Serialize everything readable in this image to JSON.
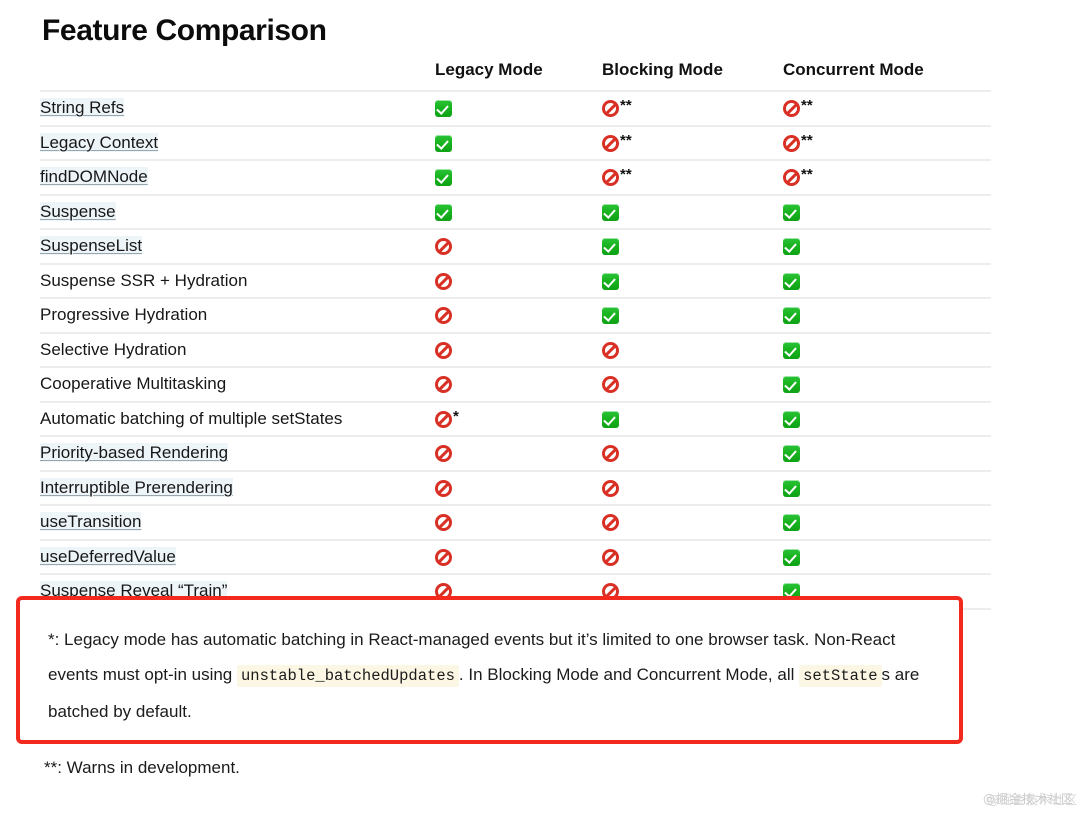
{
  "title": "Feature Comparison",
  "table": {
    "columns": [
      "",
      "Legacy Mode",
      "Blocking Mode",
      "Concurrent Mode"
    ],
    "legend": {
      "yes": "supported-check-icon",
      "no": "prohibited-icon",
      "single_star": "*",
      "double_star": "**"
    },
    "rows": [
      {
        "feature": "String Refs",
        "is_link": true,
        "legacy": "yes",
        "legacy_note": "",
        "blocking": "no",
        "blocking_note": "**",
        "concurrent": "no",
        "concurrent_note": "**"
      },
      {
        "feature": "Legacy Context",
        "is_link": true,
        "legacy": "yes",
        "legacy_note": "",
        "blocking": "no",
        "blocking_note": "**",
        "concurrent": "no",
        "concurrent_note": "**"
      },
      {
        "feature": "findDOMNode",
        "is_link": true,
        "legacy": "yes",
        "legacy_note": "",
        "blocking": "no",
        "blocking_note": "**",
        "concurrent": "no",
        "concurrent_note": "**"
      },
      {
        "feature": "Suspense",
        "is_link": true,
        "legacy": "yes",
        "legacy_note": "",
        "blocking": "yes",
        "blocking_note": "",
        "concurrent": "yes",
        "concurrent_note": ""
      },
      {
        "feature": "SuspenseList",
        "is_link": true,
        "legacy": "no",
        "legacy_note": "",
        "blocking": "yes",
        "blocking_note": "",
        "concurrent": "yes",
        "concurrent_note": ""
      },
      {
        "feature": "Suspense SSR + Hydration",
        "is_link": false,
        "legacy": "no",
        "legacy_note": "",
        "blocking": "yes",
        "blocking_note": "",
        "concurrent": "yes",
        "concurrent_note": ""
      },
      {
        "feature": "Progressive Hydration",
        "is_link": false,
        "legacy": "no",
        "legacy_note": "",
        "blocking": "yes",
        "blocking_note": "",
        "concurrent": "yes",
        "concurrent_note": ""
      },
      {
        "feature": "Selective Hydration",
        "is_link": false,
        "legacy": "no",
        "legacy_note": "",
        "blocking": "no",
        "blocking_note": "",
        "concurrent": "yes",
        "concurrent_note": ""
      },
      {
        "feature": "Cooperative Multitasking",
        "is_link": false,
        "legacy": "no",
        "legacy_note": "",
        "blocking": "no",
        "blocking_note": "",
        "concurrent": "yes",
        "concurrent_note": ""
      },
      {
        "feature": "Automatic batching of multiple setStates",
        "is_link": false,
        "legacy": "no",
        "legacy_note": "*",
        "blocking": "yes",
        "blocking_note": "",
        "concurrent": "yes",
        "concurrent_note": ""
      },
      {
        "feature": "Priority-based Rendering",
        "is_link": true,
        "legacy": "no",
        "legacy_note": "",
        "blocking": "no",
        "blocking_note": "",
        "concurrent": "yes",
        "concurrent_note": ""
      },
      {
        "feature": "Interruptible Prerendering",
        "is_link": true,
        "legacy": "no",
        "legacy_note": "",
        "blocking": "no",
        "blocking_note": "",
        "concurrent": "yes",
        "concurrent_note": ""
      },
      {
        "feature": "useTransition",
        "is_link": true,
        "legacy": "no",
        "legacy_note": "",
        "blocking": "no",
        "blocking_note": "",
        "concurrent": "yes",
        "concurrent_note": ""
      },
      {
        "feature": "useDeferredValue",
        "is_link": true,
        "legacy": "no",
        "legacy_note": "",
        "blocking": "no",
        "blocking_note": "",
        "concurrent": "yes",
        "concurrent_note": ""
      },
      {
        "feature": "Suspense Reveal “Train”",
        "is_link": true,
        "legacy": "no",
        "legacy_note": "",
        "blocking": "no",
        "blocking_note": "",
        "concurrent": "yes",
        "concurrent_note": ""
      }
    ]
  },
  "callout": {
    "border_color": "#f4291e",
    "code_bg": "#fcf7e4",
    "text_part1": "*: Legacy mode has automatic batching in React-managed events but it’s limited to one browser task. Non-React events must opt-in using ",
    "code1": "unstable_batchedUpdates",
    "text_part2": ". In Blocking Mode and Concurrent Mode, all ",
    "code2": "setState",
    "text_part3": "s are batched by default."
  },
  "footnote2": "**: Warns in development.",
  "watermark": "@掘金技术社区"
}
